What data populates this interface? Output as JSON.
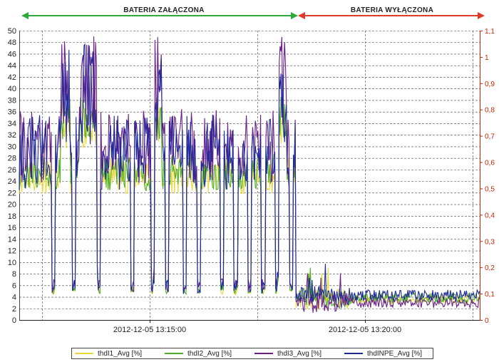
{
  "chart_data": {
    "type": "line",
    "annotations": {
      "left_band": "BATERIA ZAŁĄCZONA",
      "right_band": "BATERIA WYŁĄCZONA",
      "left_band_color": "#2eaa3a",
      "right_band_color": "#e03a2a"
    },
    "x_tick_labels": [
      "2012-12-05 13:15:00",
      "2012-12-05 13:20:00"
    ],
    "y_left": {
      "range": [
        0,
        50
      ],
      "ticks": [
        "0",
        "2",
        "4",
        "6",
        "8",
        "10",
        "12",
        "14",
        "16",
        "18",
        "20",
        "22",
        "24",
        "26",
        "28",
        "30",
        "32",
        "34",
        "36",
        "38",
        "40",
        "42",
        "44",
        "46",
        "48",
        "50"
      ]
    },
    "y_right": {
      "range": [
        0,
        1.1
      ],
      "color": "#cc2200",
      "ticks": [
        "0",
        "0,1",
        "0,2",
        "0,3",
        "0,4",
        "0,5",
        "0,6",
        "0,7",
        "0,8",
        "0,9",
        "1",
        "1,1"
      ]
    },
    "grid": true,
    "legend_position": "bottom",
    "series": [
      {
        "name": "thdI1_Avg [%]",
        "color": "#e8d838",
        "level_on": 25.0,
        "level_off": 3.6
      },
      {
        "name": "thdI2_Avg [%]",
        "color": "#4caf2a",
        "level_on": 25.5,
        "level_off": 3.8
      },
      {
        "name": "thdI3_Avg [%]",
        "color": "#6a1e8a",
        "level_on": 30.0,
        "level_off": 3.0
      },
      {
        "name": "thdINPE_Avg [%]",
        "color": "#1e2a9a",
        "level_on": 29.0,
        "level_off": 4.3
      }
    ],
    "x_segments": {
      "battery_on_fraction": 0.6
    }
  }
}
